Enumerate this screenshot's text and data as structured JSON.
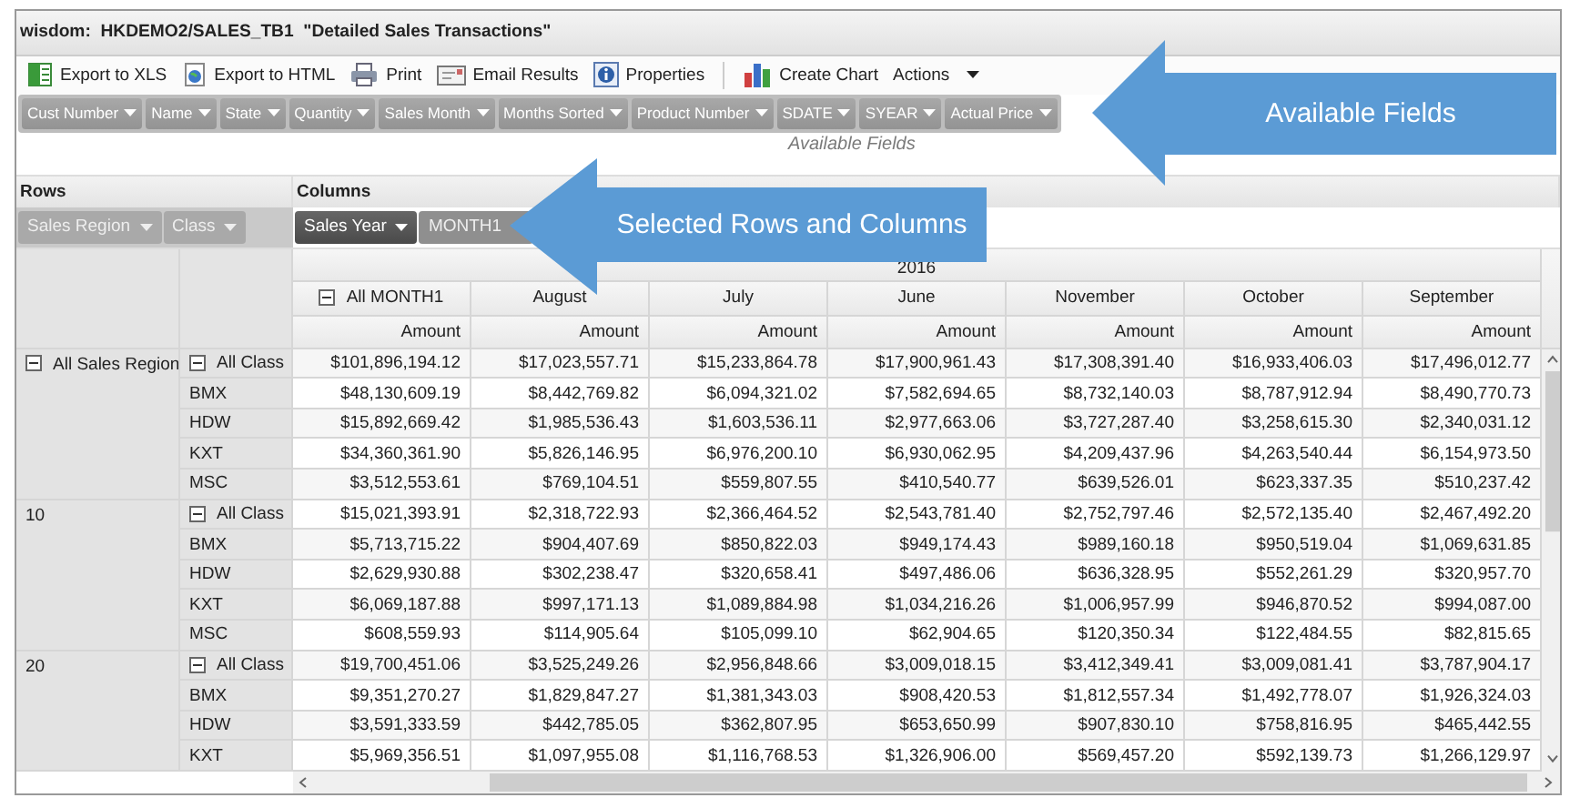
{
  "window": {
    "title": "wisdom:  HKDEMO2/SALES_TB1  \"Detailed Sales Transactions\""
  },
  "toolbar": [
    {
      "kind": "xls",
      "label": "Export to XLS"
    },
    {
      "kind": "html",
      "label": "Export to HTML"
    },
    {
      "kind": "print",
      "label": "Print"
    },
    {
      "kind": "email",
      "label": "Email Results"
    },
    {
      "kind": "properties",
      "label": "Properties"
    },
    {
      "kind": "chart",
      "label": "Create Chart"
    },
    {
      "kind": "menu",
      "label": "Actions"
    }
  ],
  "available_fields": {
    "fields": [
      "Cust Number",
      "Name",
      "State",
      "Quantity",
      "Sales Month",
      "Months Sorted",
      "Product Number",
      "SDATE",
      "SYEAR",
      "Actual Price"
    ],
    "caption": "Available Fields"
  },
  "pivot": {
    "rows_label": "Rows",
    "row_fields": [
      "Sales Region",
      "Class"
    ],
    "columns_label": "Columns",
    "column_fields": [
      {
        "label": "Sales Year",
        "selected": true
      },
      {
        "label": "MONTH1",
        "selected": false
      }
    ]
  },
  "table": {
    "year": "2016",
    "months": [
      {
        "label": "All MONTH1",
        "kind": "total",
        "expanded": true
      },
      {
        "label": "August",
        "kind": "month"
      },
      {
        "label": "July",
        "kind": "month"
      },
      {
        "label": "June",
        "kind": "month"
      },
      {
        "label": "November",
        "kind": "month"
      },
      {
        "label": "October",
        "kind": "month"
      },
      {
        "label": "September",
        "kind": "month"
      }
    ],
    "measures": [
      "Amount",
      "Amount",
      "Amount",
      "Amount",
      "Amount",
      "Amount",
      "Amount"
    ],
    "groups": [
      {
        "label": "All Sales Region",
        "kind": "total",
        "expanded": true,
        "rows": [
          {
            "label": "All Class",
            "kind": "total",
            "expanded": true,
            "values": [
              "$101,896,194.12",
              "$17,023,557.71",
              "$15,233,864.78",
              "$17,900,961.43",
              "$17,308,391.40",
              "$16,933,406.03",
              "$17,496,012.77"
            ]
          },
          {
            "label": "BMX",
            "kind": "detail",
            "values": [
              "$48,130,609.19",
              "$8,442,769.82",
              "$6,094,321.02",
              "$7,582,694.65",
              "$8,732,140.03",
              "$8,787,912.94",
              "$8,490,770.73"
            ]
          },
          {
            "label": "HDW",
            "kind": "detail",
            "values": [
              "$15,892,669.42",
              "$1,985,536.43",
              "$1,603,536.11",
              "$2,977,663.06",
              "$3,727,287.40",
              "$3,258,615.30",
              "$2,340,031.12"
            ]
          },
          {
            "label": "KXT",
            "kind": "detail",
            "values": [
              "$34,360,361.90",
              "$5,826,146.95",
              "$6,976,200.10",
              "$6,930,062.95",
              "$4,209,437.96",
              "$4,263,540.44",
              "$6,154,973.50"
            ]
          },
          {
            "label": "MSC",
            "kind": "detail",
            "values": [
              "$3,512,553.61",
              "$769,104.51",
              "$559,807.55",
              "$410,540.77",
              "$639,526.01",
              "$623,337.35",
              "$510,237.42"
            ]
          }
        ]
      },
      {
        "label": "10",
        "kind": "detail",
        "rows": [
          {
            "label": "All Class",
            "kind": "total",
            "expanded": true,
            "values": [
              "$15,021,393.91",
              "$2,318,722.93",
              "$2,366,464.52",
              "$2,543,781.40",
              "$2,752,797.46",
              "$2,572,135.40",
              "$2,467,492.20"
            ]
          },
          {
            "label": "BMX",
            "kind": "detail",
            "values": [
              "$5,713,715.22",
              "$904,407.69",
              "$850,822.03",
              "$949,174.43",
              "$989,160.18",
              "$950,519.04",
              "$1,069,631.85"
            ]
          },
          {
            "label": "HDW",
            "kind": "detail",
            "values": [
              "$2,629,930.88",
              "$302,238.47",
              "$320,658.41",
              "$497,486.06",
              "$636,328.95",
              "$552,261.29",
              "$320,957.70"
            ]
          },
          {
            "label": "KXT",
            "kind": "detail",
            "values": [
              "$6,069,187.88",
              "$997,171.13",
              "$1,089,884.98",
              "$1,034,216.26",
              "$1,006,957.99",
              "$946,870.52",
              "$994,087.00"
            ]
          },
          {
            "label": "MSC",
            "kind": "detail",
            "values": [
              "$608,559.93",
              "$114,905.64",
              "$105,099.10",
              "$62,904.65",
              "$120,350.34",
              "$122,484.55",
              "$82,815.65"
            ]
          }
        ]
      },
      {
        "label": "20",
        "kind": "detail",
        "rows": [
          {
            "label": "All Class",
            "kind": "total",
            "expanded": true,
            "values": [
              "$19,700,451.06",
              "$3,525,249.26",
              "$2,956,848.66",
              "$3,009,018.15",
              "$3,412,349.41",
              "$3,009,081.41",
              "$3,787,904.17"
            ]
          },
          {
            "label": "BMX",
            "kind": "detail",
            "values": [
              "$9,351,270.27",
              "$1,829,847.27",
              "$1,381,343.03",
              "$908,420.53",
              "$1,812,557.34",
              "$1,492,778.07",
              "$1,926,324.03"
            ]
          },
          {
            "label": "HDW",
            "kind": "detail",
            "values": [
              "$3,591,333.59",
              "$442,785.05",
              "$362,807.95",
              "$653,650.99",
              "$907,830.10",
              "$758,816.95",
              "$465,442.55"
            ]
          },
          {
            "label": "KXT",
            "kind": "detail",
            "values": [
              "$5,969,356.51",
              "$1,097,955.08",
              "$1,116,768.53",
              "$1,326,906.00",
              "$569,457.20",
              "$592,139.73",
              "$1,266,129.97"
            ]
          }
        ]
      }
    ]
  },
  "callouts": [
    {
      "text": "Available Fields"
    },
    {
      "text": "Selected Rows and Columns"
    }
  ]
}
